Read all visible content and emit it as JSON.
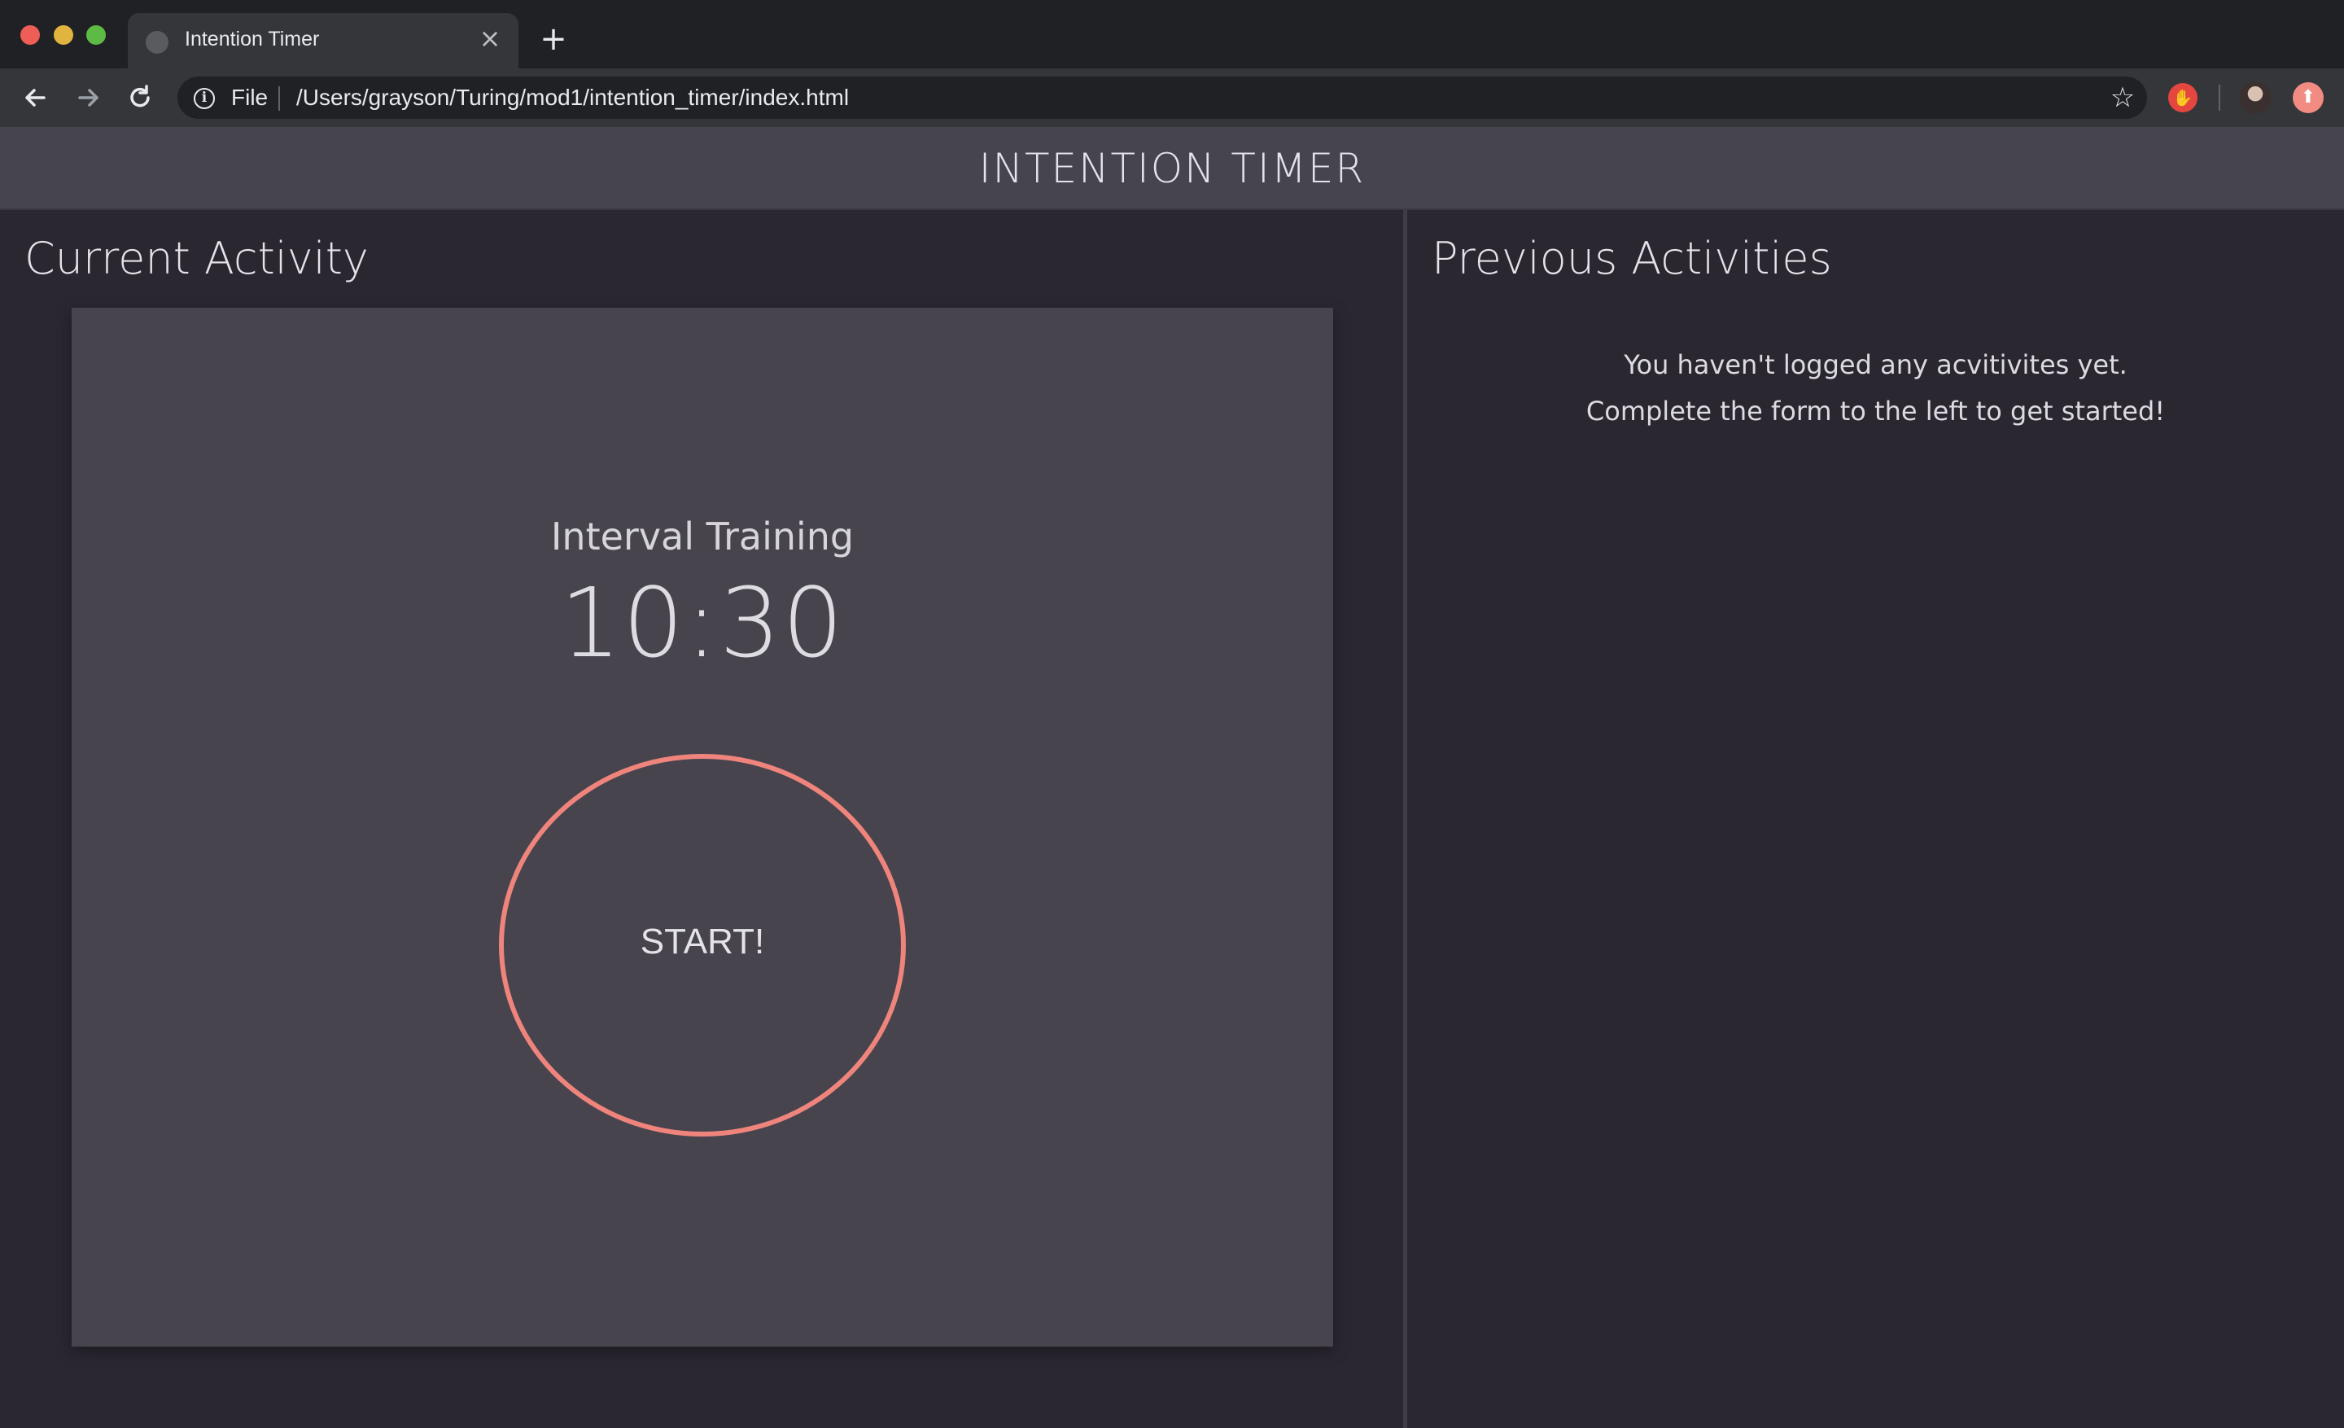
{
  "browser": {
    "tab_title": "Intention Timer",
    "tab_close": "×",
    "new_tab": "+",
    "scheme_label": "File",
    "url": "/Users/grayson/Turing/mod1/intention_timer/index.html",
    "icons": {
      "back": "arrow-left-icon",
      "forward": "arrow-right-icon",
      "reload": "reload-icon",
      "info": "info-icon",
      "star": "star-icon",
      "extension": "adblock-hand-icon",
      "profile": "avatar",
      "update": "update-arrow-icon"
    }
  },
  "header": {
    "title": "INTENTION TIMER"
  },
  "current": {
    "section_title": "Current Activity",
    "activity_name": "Interval Training",
    "time": "10:30",
    "start_label": "START!",
    "accent_color": "#ef847c"
  },
  "previous": {
    "section_title": "Previous Activities",
    "empty_line_1": "You haven't logged any acvitivites yet.",
    "empty_line_2": "Complete the form to the left to get started!"
  }
}
